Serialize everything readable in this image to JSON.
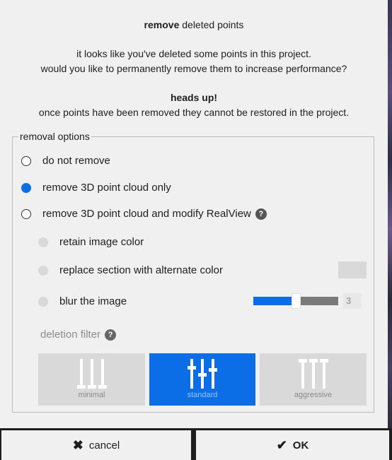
{
  "dialog": {
    "title_bold": "remove",
    "title_rest": " deleted points",
    "desc_line1": "it looks like you've deleted some points in this project.",
    "desc_line2": "would you like to permanently remove them to increase performance?",
    "heads_up": "heads up!",
    "warning": "once points have been removed they cannot be restored in the project."
  },
  "removal_options": {
    "legend": "removal options",
    "options": [
      {
        "label": "do not remove",
        "selected": false
      },
      {
        "label": "remove 3D point cloud only",
        "selected": true
      },
      {
        "label": "remove 3D point cloud and modify RealView",
        "selected": false
      }
    ],
    "sub_options": [
      {
        "label": "retain image color"
      },
      {
        "label": "replace section with alternate color"
      },
      {
        "label": "blur the image"
      }
    ],
    "blur_value": "3",
    "help_glyph": "?"
  },
  "deletion_filter": {
    "label": "deletion filter",
    "buttons": [
      {
        "label": "minimal",
        "active": false
      },
      {
        "label": "standard",
        "active": true
      },
      {
        "label": "aggressive",
        "active": false
      }
    ]
  },
  "footer": {
    "cancel_label": "cancel",
    "ok_label": "OK"
  },
  "colors": {
    "accent": "#0b6ee6",
    "dialog_bg": "#f0f0f0"
  }
}
